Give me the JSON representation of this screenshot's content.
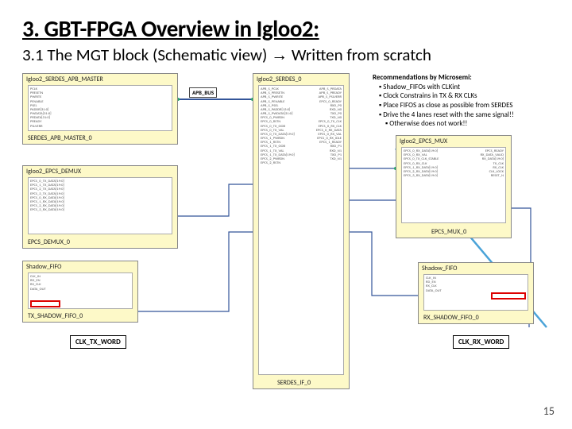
{
  "title": "3. GBT-FPGA Overview in Igloo2:",
  "subtitle_pre": "3.1 The MGT block (Schematic view) ",
  "subtitle_arrow": "→",
  "subtitle_post": " Written from scratch",
  "page_number": "15",
  "labels": {
    "apb_bus": "APB_BUS",
    "clk_tx_word": "CLK_TX_WORD",
    "clk_rx_word": "CLK_RX_WORD"
  },
  "blocks": {
    "apb_master": {
      "title": "Igloo2_SERDES_APB_MASTER",
      "inst": "SERDES_APB_MASTER_0",
      "ports_left": [
        "PCLK",
        "PRESETN",
        "PWRITE",
        "PENABLE",
        "PSEL",
        "PADDR[31:0]",
        "PWDATA[31:0]",
        "PRDATA[31:0]",
        "PREADY",
        "PSLVERR"
      ]
    },
    "epcs_demux": {
      "title": "Igloo2_EPCS_DEMUX",
      "inst": "EPCS_DEMUX_0",
      "ports_left": [
        "EPCS_0_TX_DATA[19:0]",
        "EPCS_1_TX_DATA[19:0]",
        "EPCS_2_TX_DATA[19:0]",
        "EPCS_3_TX_DATA[19:0]",
        "EPCS_0_RX_DATA[19:0]",
        "EPCS_1_RX_DATA[19:0]",
        "EPCS_2_RX_DATA[19:0]",
        "EPCS_3_RX_DATA[19:0]"
      ]
    },
    "shadow_tx": {
      "title": "Shadow_FIFO",
      "inst": "TX_SHADOW_FIFO_0",
      "ports": [
        "CLK_IN",
        "RD_EN",
        "RX_CLK",
        "DATA_OUT"
      ]
    },
    "serdes": {
      "title": "Igloo2_SERDES_0",
      "inst": "SERDES_IF_0",
      "ports_left": [
        "APB_S_PCLK",
        "APB_S_PRESETN",
        "APB_S_PWRITE",
        "APB_S_PENABLE",
        "APB_S_PSEL",
        "APB_S_PADDR[13:0]",
        "APB_S_PWDATA[31:0]",
        "EPCS_0_PWRDN",
        "EPCS_0_RSTN",
        "EPCS_0_TX_OOB",
        "EPCS_0_TX_VAL",
        "EPCS_0_TX_DATA[19:0]",
        "EPCS_1_PWRDN",
        "EPCS_1_RSTN",
        "EPCS_1_TX_OOB",
        "EPCS_1_TX_VAL",
        "EPCS_1_TX_DATA[19:0]",
        "EPCS_2_PWRDN",
        "EPCS_2_RSTN"
      ],
      "ports_right": [
        "APB_S_PRDATA",
        "APB_S_PREADY",
        "APB_S_PSLVERR",
        "EPCS_0_READY",
        "RXD_P0",
        "RXD_N0",
        "TXD_P0",
        "TXD_N0",
        "EPCS_0_TX_CLK",
        "EPCS_0_RX_CLK",
        "EPCS_0_RX_DATA",
        "EPCS_0_RX_VAL",
        "EPCS_0_RX_IDLE",
        "EPCS_1_READY",
        "RXD_P1",
        "RXD_N1",
        "TXD_P1",
        "TXD_N1"
      ]
    },
    "epcs_mux": {
      "title": "Igloo2_EPCS_MUX",
      "inst": "EPCS_MUX_0",
      "ports_left": [
        "EPCS_0_RX_DATA[19:0]",
        "EPCS_0_RX_VAL",
        "EPCS_0_TX_CLK_STABLE",
        "EPCS_0_RX_CLK",
        "EPCS_1_RX_DATA[19:0]",
        "EPCS_2_RX_DATA[19:0]",
        "EPCS_3_RX_DATA[19:0]"
      ],
      "ports_right": [
        "EPCS_READY",
        "RX_DATA_VALID",
        "RX_DATA[19:0]",
        "TX_CLK",
        "RX_CLK",
        "CLK_LOCK",
        "RESET_N"
      ]
    },
    "shadow_rx": {
      "title": "Shadow_FIFO",
      "inst": "RX_SHADOW_FIFO_0",
      "ports": [
        "CLK_IN",
        "RD_EN",
        "RX_CLK",
        "DATA_OUT"
      ]
    }
  },
  "recs": {
    "header": "Recommendations by Microsemi:",
    "items": [
      "Shadow_FIFOs with CLKint",
      "Clock Constrains in TX & RX CLKs",
      "Place FIFOS as close as possible from SERDES",
      "Drive the 4 lanes reset with the same signal!!"
    ],
    "subnote": "Otherwise does not work!!"
  }
}
